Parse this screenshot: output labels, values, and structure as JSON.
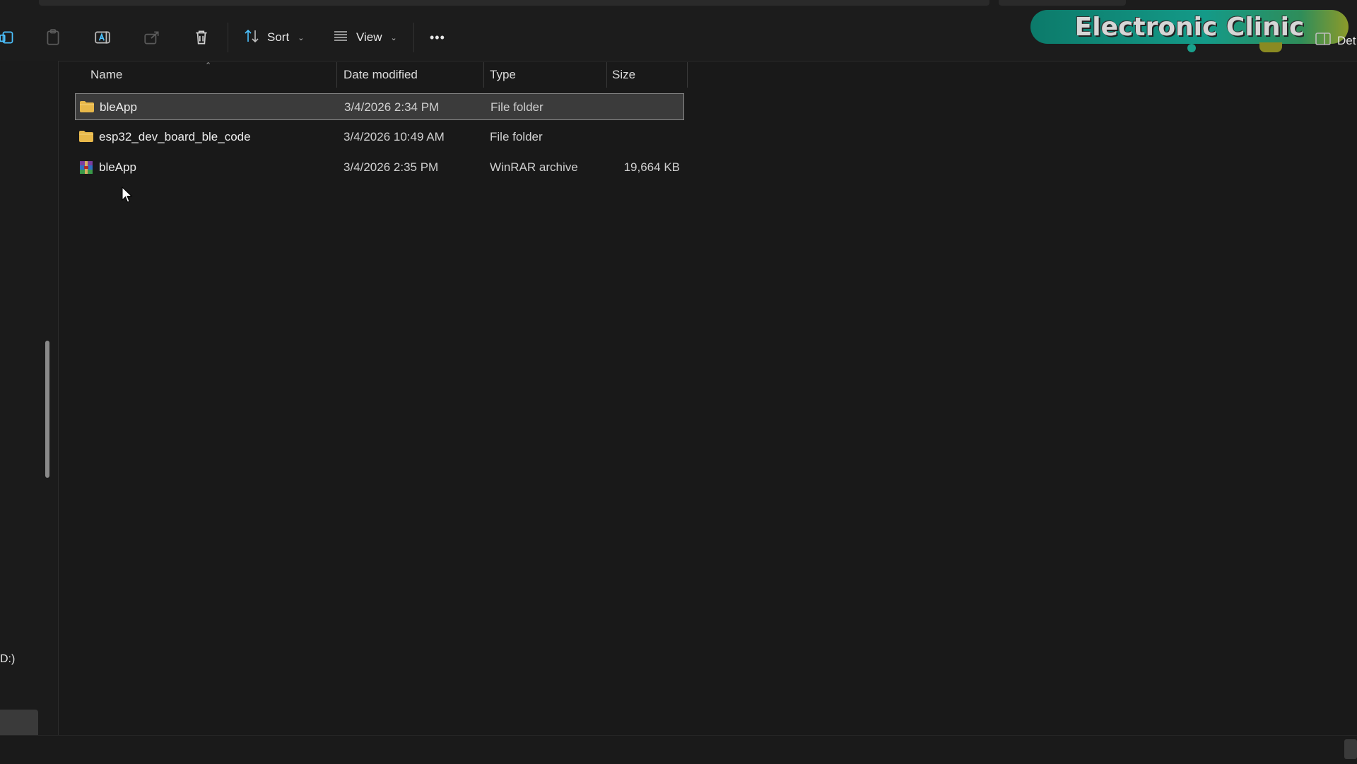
{
  "toolbar": {
    "sort_label": "Sort",
    "view_label": "View",
    "more_label": "•••",
    "details_label": "Det"
  },
  "watermark": {
    "text": "Electronic Clinic"
  },
  "columns": {
    "name": "Name",
    "date": "Date modified",
    "type": "Type",
    "size": "Size"
  },
  "files": [
    {
      "name": "bleApp",
      "date": "3/4/2026 2:34 PM",
      "type": "File folder",
      "size": "",
      "icon": "folder-icon",
      "selected": true
    },
    {
      "name": "esp32_dev_board_ble_code",
      "date": "3/4/2026 10:49 AM",
      "type": "File folder",
      "size": "",
      "icon": "folder-icon",
      "selected": false
    },
    {
      "name": "bleApp",
      "date": "3/4/2026 2:35 PM",
      "type": "WinRAR archive",
      "size": "19,664 KB",
      "icon": "winrar-archive-icon",
      "selected": false
    }
  ],
  "nav": {
    "drive_label": "D:)"
  },
  "colors": {
    "background": "#191919",
    "selection": "#3b3b3b",
    "folder": "#e8b84a",
    "accent": "#4cc2ff"
  }
}
